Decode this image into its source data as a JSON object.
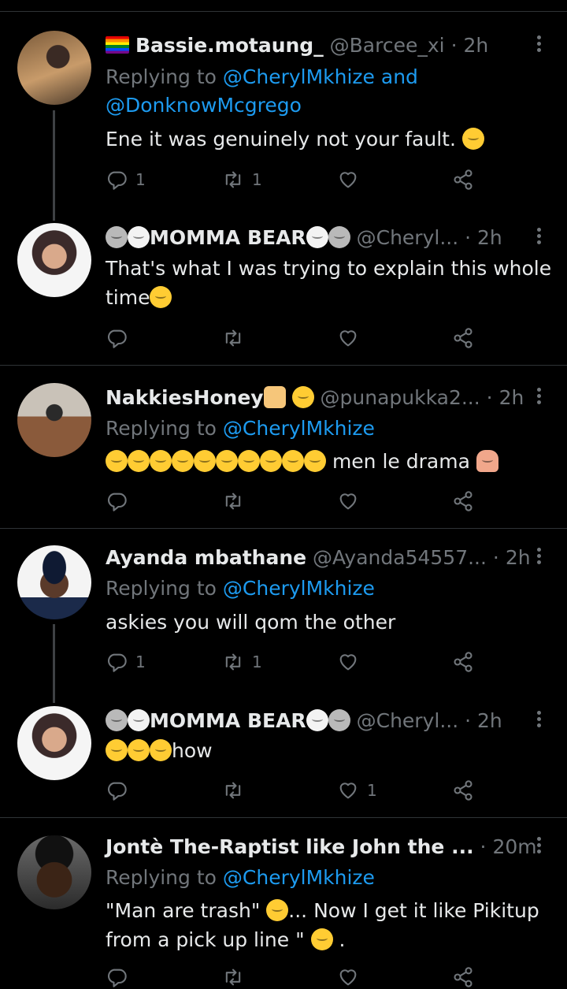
{
  "tweets": [
    {
      "author": {
        "name": "Bassie.motaung_",
        "handle": "@Barcee_xi",
        "time": "2h",
        "avatar": "avatar-woman-standing"
      },
      "replying_to": {
        "prefix": "Replying to ",
        "mention1": "@CherylMkhize",
        "join": " and",
        "mention2": "@DonknowMcgrego"
      },
      "text": "Ene it was genuinely not your fault.",
      "stats": {
        "replies": "1",
        "retweets": "1",
        "likes": ""
      }
    },
    {
      "author": {
        "name": "MOMMA BEAR",
        "handle": "@Cheryl...",
        "time": "2h",
        "avatar": "avatar-woman-selfie"
      },
      "text_line1": "That's what I was trying to explain this whole",
      "text_line2": "time",
      "stats": {
        "replies": "",
        "retweets": "",
        "likes": ""
      }
    },
    {
      "author": {
        "name": "NakkiesHoney",
        "handle": "@punapukka2...",
        "time": "2h",
        "avatar": "avatar-woman-outdoor"
      },
      "replying_to": {
        "prefix": "Replying to ",
        "mention1": "@CherylMkhize"
      },
      "text": "men le drama",
      "stats": {
        "replies": "",
        "retweets": "",
        "likes": ""
      }
    },
    {
      "author": {
        "name": "Ayanda mbathane",
        "handle": "@Ayanda54557...",
        "time": "2h",
        "avatar": "avatar-man-cap"
      },
      "replying_to": {
        "prefix": "Replying to ",
        "mention1": "@CherylMkhize"
      },
      "text": "askies you will qom the other",
      "stats": {
        "replies": "1",
        "retweets": "1",
        "likes": ""
      }
    },
    {
      "author": {
        "name": "MOMMA BEAR",
        "handle": "@Cheryl...",
        "time": "2h",
        "avatar": "avatar-woman-selfie"
      },
      "text": "how",
      "stats": {
        "replies": "",
        "retweets": "",
        "likes": "1"
      }
    },
    {
      "author": {
        "name": "Jontè The-Raptist like John the ...",
        "handle": "",
        "time": "20m",
        "avatar": "avatar-man-selfie"
      },
      "replying_to": {
        "prefix": "Replying to ",
        "mention1": "@CherylMkhize"
      },
      "text_line1a": "\"Man are trash\"",
      "text_line1b": "... Now I get it like Pikitup",
      "text_line2a": "from a pick up line \"",
      "text_line2b": "."
    }
  ],
  "separator": "·",
  "colors": {
    "background": "#000000",
    "text": "#e7e9ea",
    "muted": "#71767b",
    "link": "#1d9bf0",
    "divider": "#2f3336"
  }
}
